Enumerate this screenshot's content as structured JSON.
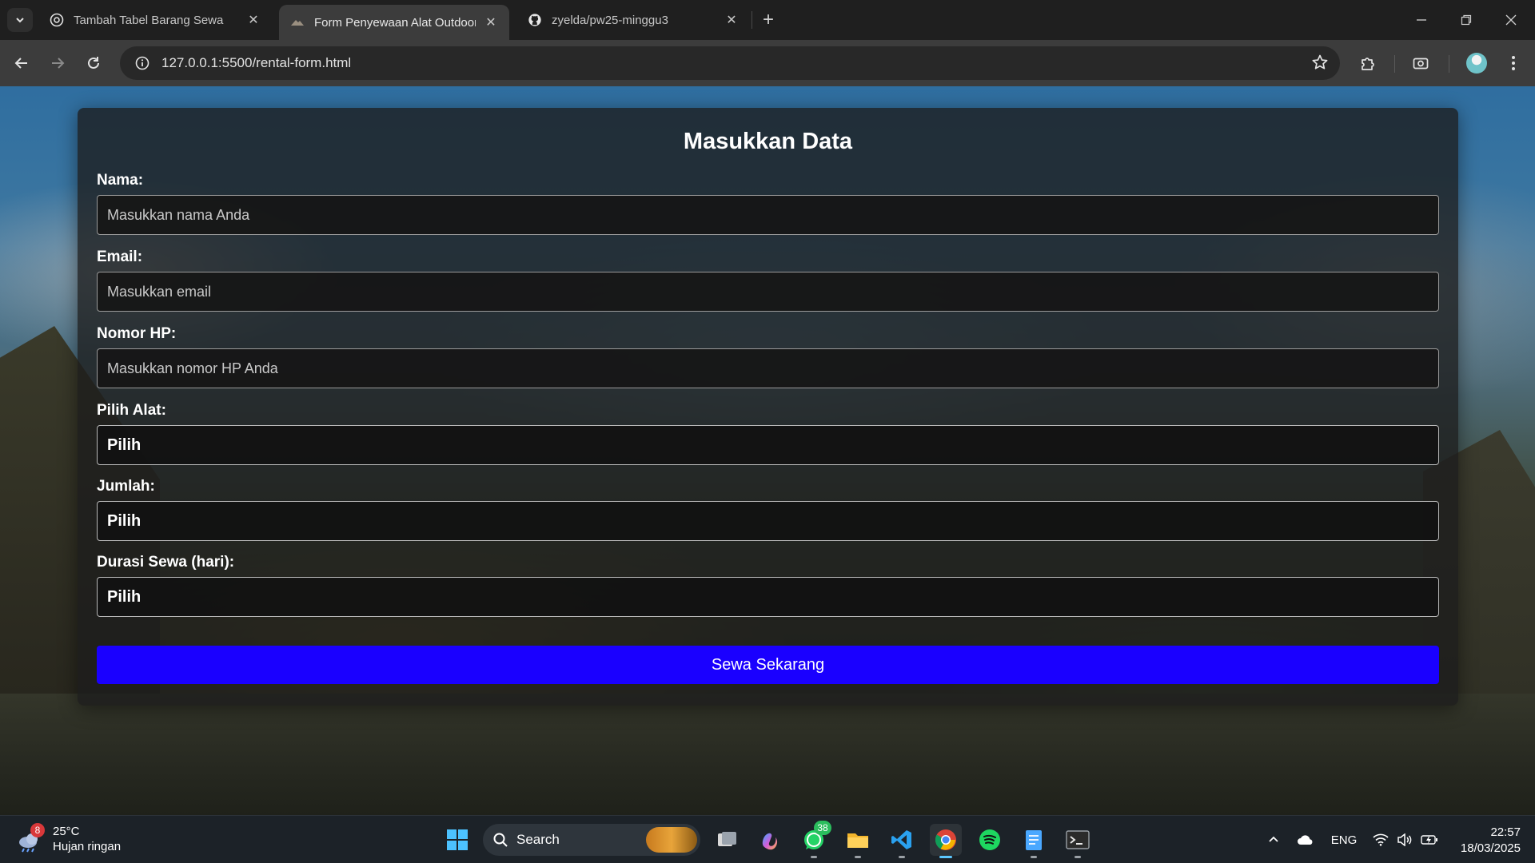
{
  "browser": {
    "tabs": [
      {
        "title": "Tambah Tabel Barang Sewa",
        "active": false,
        "icon": "chatgpt-icon"
      },
      {
        "title": "Form Penyewaan Alat Outdoor",
        "active": true,
        "icon": "mountain-icon"
      },
      {
        "title": "zyelda/pw25-minggu3",
        "active": false,
        "icon": "github-icon"
      }
    ],
    "url": "127.0.0.1:5500/rental-form.html"
  },
  "form": {
    "heading": "Masukkan Data",
    "fields": {
      "nama": {
        "label": "Nama:",
        "placeholder": "Masukkan nama Anda",
        "value": ""
      },
      "email": {
        "label": "Email:",
        "placeholder": "Masukkan email",
        "value": ""
      },
      "hp": {
        "label": "Nomor HP:",
        "placeholder": "Masukkan nomor HP Anda",
        "value": ""
      },
      "alat": {
        "label": "Pilih Alat:",
        "selected": "Pilih"
      },
      "jumlah": {
        "label": "Jumlah:",
        "selected": "Pilih"
      },
      "durasi": {
        "label": "Durasi Sewa (hari):",
        "selected": "Pilih"
      }
    },
    "submit_label": "Sewa Sekarang",
    "submit_color": "#1a00ff"
  },
  "taskbar": {
    "weather": {
      "temp": "25°C",
      "condition": "Hujan ringan",
      "badge": "8"
    },
    "search_label": "Search",
    "whatsapp_badge": "38",
    "language": "ENG",
    "time": "22:57",
    "date": "18/03/2025",
    "apps": [
      "windows-start-icon",
      "task-view-icon",
      "copilot-icon",
      "whatsapp-icon",
      "file-explorer-icon",
      "vscode-icon",
      "chrome-icon",
      "spotify-icon",
      "notepad-icon",
      "terminal-icon"
    ]
  }
}
